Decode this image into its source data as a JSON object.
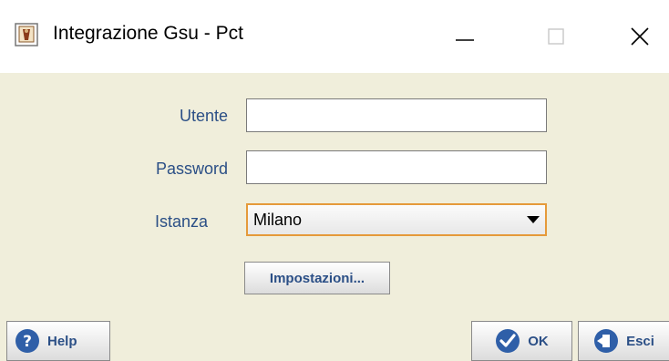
{
  "window": {
    "title": "Integrazione Gsu - Pct",
    "app_icon": "app-document-icon",
    "controls": {
      "minimize_icon": "minimize-icon",
      "maximize_icon": "maximize-icon",
      "close_icon": "close-icon"
    }
  },
  "form": {
    "user_label": "Utente",
    "user_value": "",
    "password_label": "Password",
    "password_value": "",
    "instance_label": "Istanza",
    "instance_selected": "Milano",
    "settings_button": "Impostazioni..."
  },
  "footer": {
    "help_label": "Help",
    "ok_label": "OK",
    "exit_label": "Esci"
  },
  "colors": {
    "window_bg": "#f0eedb",
    "label_text": "#2b4f86",
    "select_focus_border": "#e59a3a",
    "icon_blue": "#2f5fa8"
  }
}
